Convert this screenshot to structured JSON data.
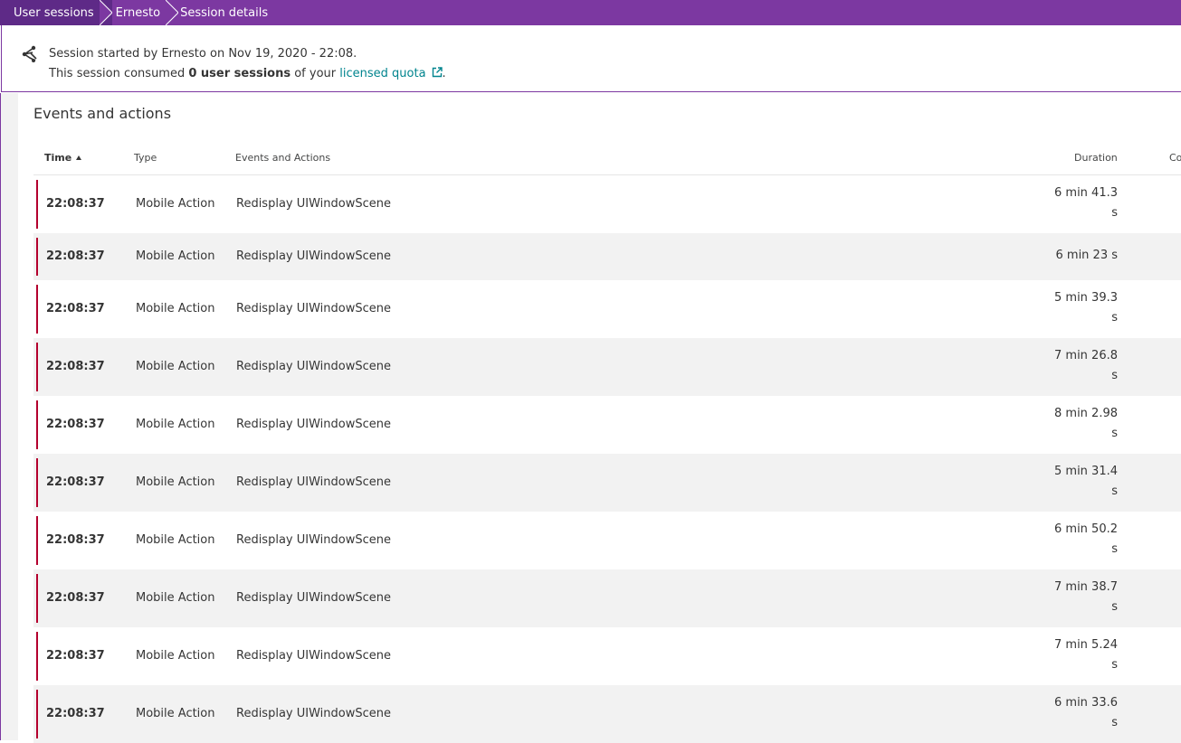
{
  "breadcrumb": {
    "items": [
      {
        "label": "User sessions"
      },
      {
        "label": "Ernesto"
      },
      {
        "label": "Session details"
      }
    ]
  },
  "session_info": {
    "line1": "Session started by Ernesto on Nov 19, 2020 - 22:08.",
    "line2_prefix": "This session consumed ",
    "line2_bold": "0 user sessions",
    "line2_mid": " of your ",
    "link_label": "licensed quota",
    "line2_suffix": "."
  },
  "events_section": {
    "title": "Events and actions",
    "columns": {
      "time": "Time",
      "type": "Type",
      "events": "Events and Actions",
      "duration": "Duration",
      "co": "Co"
    },
    "rows": [
      {
        "time": "22:08:37",
        "type": "Mobile Action",
        "event": "Redisplay UIWindowScene",
        "duration": "6 min 41.3 s"
      },
      {
        "time": "22:08:37",
        "type": "Mobile Action",
        "event": "Redisplay UIWindowScene",
        "duration": "6 min 23 s"
      },
      {
        "time": "22:08:37",
        "type": "Mobile Action",
        "event": "Redisplay UIWindowScene",
        "duration": "5 min 39.3 s"
      },
      {
        "time": "22:08:37",
        "type": "Mobile Action",
        "event": "Redisplay UIWindowScene",
        "duration": "7 min 26.8 s"
      },
      {
        "time": "22:08:37",
        "type": "Mobile Action",
        "event": "Redisplay UIWindowScene",
        "duration": "8 min 2.98 s"
      },
      {
        "time": "22:08:37",
        "type": "Mobile Action",
        "event": "Redisplay UIWindowScene",
        "duration": "5 min 31.4 s"
      },
      {
        "time": "22:08:37",
        "type": "Mobile Action",
        "event": "Redisplay UIWindowScene",
        "duration": "6 min 50.2 s"
      },
      {
        "time": "22:08:37",
        "type": "Mobile Action",
        "event": "Redisplay UIWindowScene",
        "duration": "7 min 38.7 s"
      },
      {
        "time": "22:08:37",
        "type": "Mobile Action",
        "event": "Redisplay UIWindowScene",
        "duration": "7 min 5.24 s"
      },
      {
        "time": "22:08:37",
        "type": "Mobile Action",
        "event": "Redisplay UIWindowScene",
        "duration": "6 min 33.6 s"
      }
    ]
  },
  "colors": {
    "breadcrumb_bg": "#7c38a1",
    "breadcrumb_first_bg": "#5e2a87",
    "link": "#00848e",
    "row_stripe": "#b4002e"
  }
}
